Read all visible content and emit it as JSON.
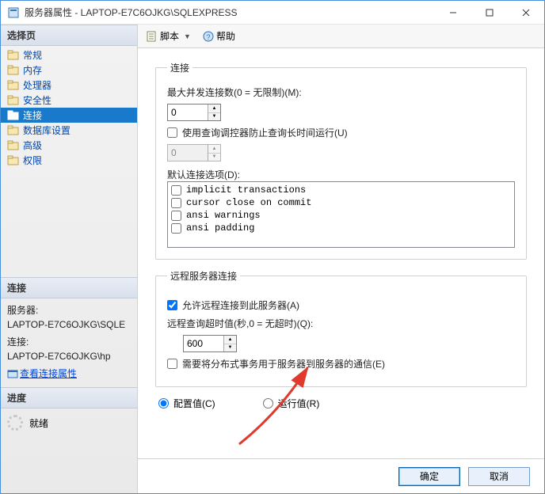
{
  "window": {
    "title": "服务器属性 - LAPTOP-E7C6OJKG\\SQLEXPRESS"
  },
  "left": {
    "select_page": "选择页",
    "nav": [
      {
        "label": "常规"
      },
      {
        "label": "内存"
      },
      {
        "label": "处理器"
      },
      {
        "label": "安全性"
      },
      {
        "label": "连接",
        "selected": true
      },
      {
        "label": "数据库设置"
      },
      {
        "label": "高级"
      },
      {
        "label": "权限"
      }
    ],
    "connection_h": "连接",
    "connection": {
      "server_label": "服务器:",
      "server_value": "LAPTOP-E7C6OJKG\\SQLE",
      "conn_label": "连接:",
      "conn_value": "LAPTOP-E7C6OJKG\\hp",
      "view_props": "查看连接属性"
    },
    "progress_h": "进度",
    "progress_state": "就绪"
  },
  "toolbar": {
    "script": "脚本",
    "help": "帮助"
  },
  "groups": {
    "connections": {
      "legend": "连接",
      "max_conn_label": "最大并发连接数(0 = 无限制)(M):",
      "max_conn_value": "0",
      "governor_label": "使用查询调控器防止查询长时间运行(U)",
      "governor_value": "0",
      "default_opts_label": "默认连接选项(D):",
      "options": [
        "implicit transactions",
        "cursor close on commit",
        "ansi warnings",
        "ansi padding"
      ]
    },
    "remote": {
      "legend": "远程服务器连接",
      "allow_remote_label": "允许远程连接到此服务器(A)",
      "timeout_label": "远程查询超时值(秒,0 = 无超时)(Q):",
      "timeout_value": "600",
      "dtc_label": "需要将分布式事务用于服务器到服务器的通信(E)"
    }
  },
  "mode": {
    "configured": "配置值(C)",
    "running": "运行值(R)"
  },
  "footer": {
    "ok": "确定",
    "cancel": "取消"
  }
}
